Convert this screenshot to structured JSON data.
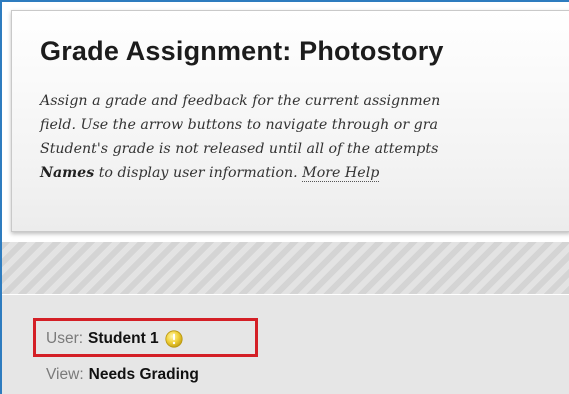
{
  "header": {
    "title": "Grade Assignment: Photostory",
    "instructions": {
      "line1": "Assign a grade and feedback for the current assignmen",
      "line2": "field. Use the arrow buttons to navigate through or gra",
      "line3": "Student's grade is not released until all of the attempts",
      "line4_bold": "Names",
      "line4_rest": " to display user information. ",
      "help_link": "More Help"
    }
  },
  "info": {
    "user_label": "User:",
    "user_value": "Student 1",
    "user_status_icon": "warning-icon",
    "view_label": "View:",
    "view_value": "Needs Grading"
  },
  "colors": {
    "frame_border": "#2e7cbf",
    "highlight": "#d41f26",
    "warning_icon": "#f2d23c"
  }
}
